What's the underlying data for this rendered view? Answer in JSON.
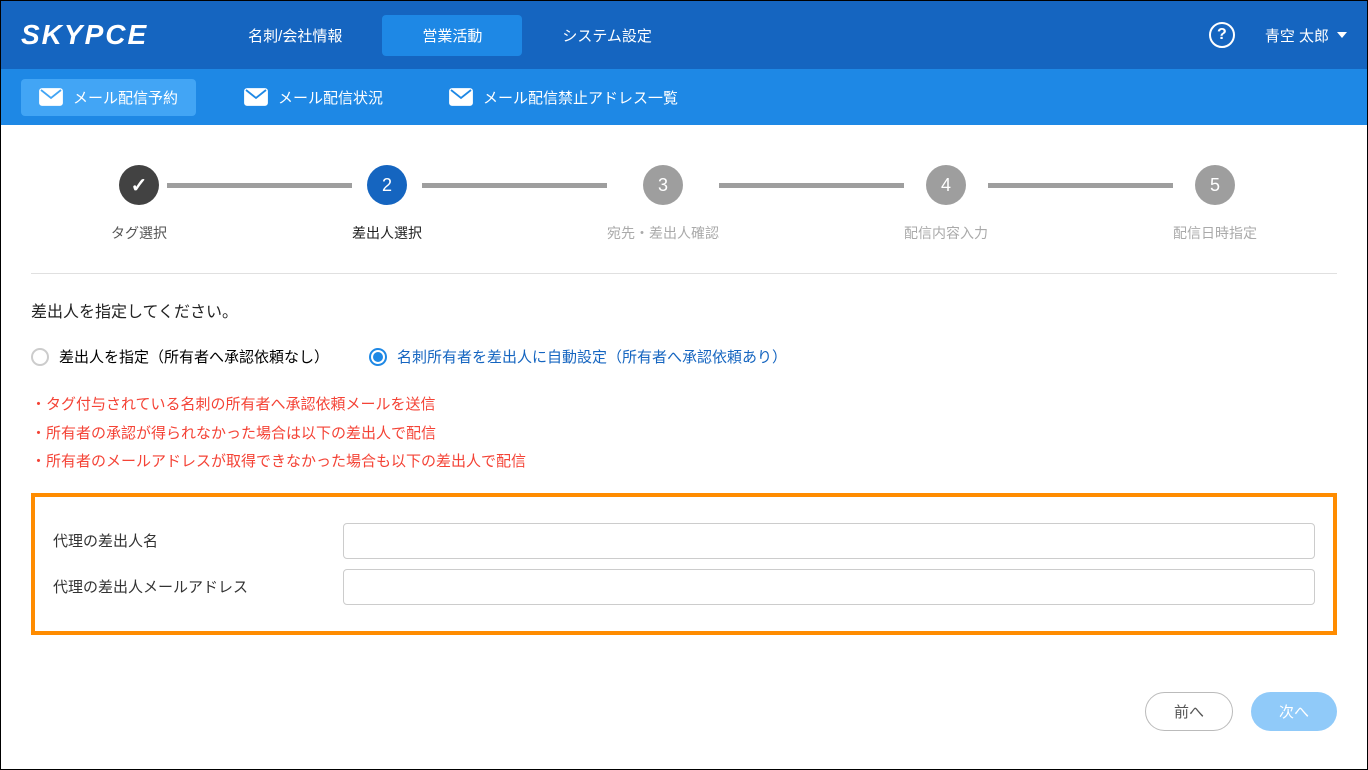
{
  "header": {
    "logo": "SKYPCE",
    "tabs": [
      {
        "label": "名刺/会社情報"
      },
      {
        "label": "営業活動"
      },
      {
        "label": "システム設定"
      }
    ],
    "user_name": "青空 太郎"
  },
  "sub_nav": {
    "items": [
      {
        "label": "メール配信予約"
      },
      {
        "label": "メール配信状況"
      },
      {
        "label": "メール配信禁止アドレス一覧"
      }
    ]
  },
  "stepper": {
    "steps": [
      {
        "num": "✓",
        "label": "タグ選択"
      },
      {
        "num": "2",
        "label": "差出人選択"
      },
      {
        "num": "3",
        "label": "宛先・差出人確認"
      },
      {
        "num": "4",
        "label": "配信内容入力"
      },
      {
        "num": "5",
        "label": "配信日時指定"
      }
    ]
  },
  "instruction": "差出人を指定してください。",
  "radios": {
    "opt1": "差出人を指定（所有者へ承認依頼なし）",
    "opt2": "名刺所有者を差出人に自動設定（所有者へ承認依頼あり）"
  },
  "notes": {
    "line1": "・タグ付与されている名刺の所有者へ承認依頼メールを送信",
    "line2": "・所有者の承認が得られなかった場合は以下の差出人で配信",
    "line3": "・所有者のメールアドレスが取得できなかった場合も以下の差出人で配信"
  },
  "form": {
    "label1": "代理の差出人名",
    "label2": "代理の差出人メールアドレス",
    "value1": "",
    "value2": ""
  },
  "buttons": {
    "prev": "前へ",
    "next": "次へ"
  }
}
